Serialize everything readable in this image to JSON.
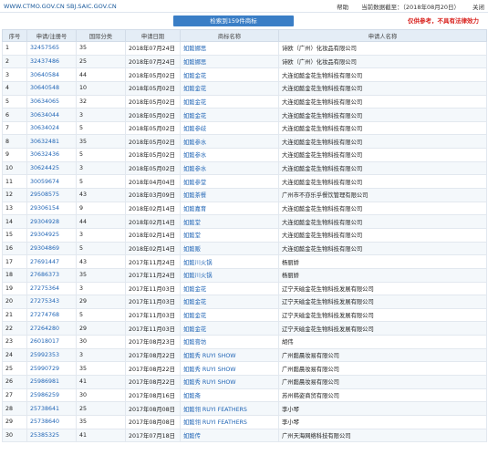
{
  "topbar": {
    "site": "WWW.CTMO.GOV.CN SBJ.SAIC.GOV.CN",
    "help": "帮助",
    "data_date": "当前数据截至：（2018年08月20日）",
    "close": "关闭"
  },
  "banner": {
    "result_label": "检索到159件商标",
    "notice": "仅供参考，不具有法律效力"
  },
  "table": {
    "headers": [
      "序号",
      "申请/注册号",
      "国际分类",
      "申请日期",
      "商标名称",
      "申请人名称"
    ],
    "rows": [
      [
        "1",
        "32457565",
        "35",
        "2018年07月24日",
        "如懿娜思",
        "诗欧（广州）化妆品有限公司"
      ],
      [
        "2",
        "32437486",
        "25",
        "2018年07月24日",
        "如懿娜思",
        "诗欧（广州）化妆品有限公司"
      ],
      [
        "3",
        "30640584",
        "44",
        "2018年05月02日",
        "如懿金花",
        "大连如懿金花生物科技有限公司"
      ],
      [
        "4",
        "30640548",
        "10",
        "2018年05月02日",
        "如懿金花",
        "大连如懿金花生物科技有限公司"
      ],
      [
        "5",
        "30634065",
        "32",
        "2018年05月02日",
        "如懿金花",
        "大连如懿金花生物科技有限公司"
      ],
      [
        "6",
        "30634044",
        "3",
        "2018年05月02日",
        "如懿金花",
        "大连如懿金花生物科技有限公司"
      ],
      [
        "7",
        "30634024",
        "5",
        "2018年05月02日",
        "如懿参歧",
        "大连如懿金花生物科技有限公司"
      ],
      [
        "8",
        "30632481",
        "35",
        "2018年05月02日",
        "如懿参水",
        "大连如懿金花生物科技有限公司"
      ],
      [
        "9",
        "30632436",
        "5",
        "2018年05月02日",
        "如懿参水",
        "大连如懿金花生物科技有限公司"
      ],
      [
        "10",
        "30624425",
        "3",
        "2018年05月02日",
        "如懿参水",
        "大连如懿金花生物科技有限公司"
      ],
      [
        "11",
        "30059674",
        "5",
        "2018年04月04日",
        "如懿参堂",
        "大连如懿金花生物科技有限公司"
      ],
      [
        "12",
        "29508575",
        "43",
        "2018年03月09日",
        "如懿茶餐",
        "广州市不亦乐乎餐饮管理有限公司"
      ],
      [
        "13",
        "29306154",
        "9",
        "2018年02月14日",
        "如懿嘉育",
        "大连如懿金花生物科技有限公司"
      ],
      [
        "14",
        "29304928",
        "44",
        "2018年02月14日",
        "如懿堂",
        "大连如懿金花生物科技有限公司"
      ],
      [
        "15",
        "29304925",
        "3",
        "2018年02月14日",
        "如懿堂",
        "大连如懿金花生物科技有限公司"
      ],
      [
        "16",
        "29304869",
        "5",
        "2018年02月14日",
        "如懿贩",
        "大连如懿金花生物科技有限公司"
      ],
      [
        "17",
        "27691447",
        "43",
        "2017年11月24日",
        "如懿川火锅",
        "杨丽娇"
      ],
      [
        "18",
        "27686373",
        "35",
        "2017年11月24日",
        "如懿川火锅",
        "杨丽娇"
      ],
      [
        "19",
        "27275364",
        "3",
        "2017年11月03日",
        "如懿金花",
        "辽宁天磁金花生物科技发展有限公司"
      ],
      [
        "20",
        "27275343",
        "29",
        "2017年11月03日",
        "如懿金花",
        "辽宁天磁金花生物科技发展有限公司"
      ],
      [
        "21",
        "27274768",
        "5",
        "2017年11月03日",
        "如懿金花",
        "辽宁天磁金花生物科技发展有限公司"
      ],
      [
        "22",
        "27264280",
        "29",
        "2017年11月03日",
        "如懿金花",
        "辽宁天磁金花生物科技发展有限公司"
      ],
      [
        "23",
        "26018017",
        "30",
        "2017年08月23日",
        "如懿膏坊",
        "胡伟"
      ],
      [
        "24",
        "25992353",
        "3",
        "2017年08月22日",
        "如懿秀 RUYI SHOW",
        "广州懿晨妆易有限公司"
      ],
      [
        "25",
        "25990729",
        "35",
        "2017年08月22日",
        "如懿秀 RUYI SHOW",
        "广州懿晨妆易有限公司"
      ],
      [
        "26",
        "25986981",
        "41",
        "2017年08月22日",
        "如懿秀 RUYI SHOW",
        "广州懿晨妆易有限公司"
      ],
      [
        "27",
        "25986259",
        "30",
        "2017年08月16日",
        "如懿斋",
        "苏州韩姿商贸有限公司"
      ],
      [
        "28",
        "25738641",
        "25",
        "2017年08月08日",
        "如懿翎 RUYI FEATHERS",
        "李小琴"
      ],
      [
        "29",
        "25738640",
        "35",
        "2017年08月08日",
        "如懿翎 RUYI FEATHERS",
        "李小琴"
      ],
      [
        "30",
        "25385325",
        "41",
        "2017年07月18日",
        "如懿传",
        "广州天海网络科技有限公司"
      ]
    ]
  }
}
